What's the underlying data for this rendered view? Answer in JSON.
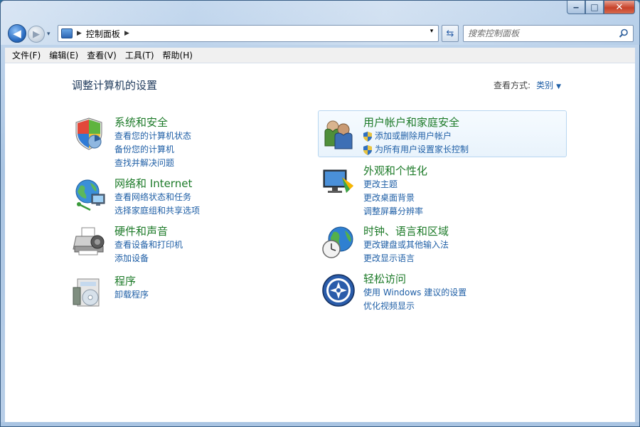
{
  "window": {
    "caption": {
      "minimize": "‒",
      "maximize": "□",
      "close": "✕"
    }
  },
  "navigation": {
    "back_glyph": "◀",
    "forward_glyph": "▶",
    "history_glyph": "▾",
    "address": {
      "separator": "▶",
      "path": "控制面板",
      "dropdown": "▾"
    },
    "refresh_glyph": "⇆",
    "search": {
      "placeholder": "搜索控制面板"
    }
  },
  "menu": {
    "items": [
      "文件(F)",
      "编辑(E)",
      "查看(V)",
      "工具(T)",
      "帮助(H)"
    ]
  },
  "content": {
    "title": "调整计算机的设置",
    "view_by": {
      "label": "查看方式:",
      "value": "类别",
      "arrow": "▼"
    },
    "categories": [
      {
        "title": "系统和安全",
        "icon": "shield-icon",
        "links": [
          "查看您的计算机状态",
          "备份您的计算机",
          "查找并解决问题"
        ]
      },
      {
        "title": "网络和 Internet",
        "icon": "network-icon",
        "links": [
          "查看网络状态和任务",
          "选择家庭组和共享选项"
        ]
      },
      {
        "title": "硬件和声音",
        "icon": "printer-icon",
        "links": [
          "查看设备和打印机",
          "添加设备"
        ]
      },
      {
        "title": "程序",
        "icon": "programs-icon",
        "links": [
          "卸载程序"
        ]
      },
      {
        "title": "用户帐户和家庭安全",
        "icon": "users-icon",
        "links": [
          "添加或删除用户帐户",
          "为所有用户设置家长控制"
        ]
      },
      {
        "title": "外观和个性化",
        "icon": "monitor-icon",
        "links": [
          "更改主题",
          "更改桌面背景",
          "调整屏幕分辨率"
        ]
      },
      {
        "title": "时钟、语言和区域",
        "icon": "clock-globe-icon",
        "links": [
          "更改键盘或其他输入法",
          "更改显示语言"
        ]
      },
      {
        "title": "轻松访问",
        "icon": "ease-of-access-icon",
        "links": [
          "使用 Windows 建议的设置",
          "优化视频显示"
        ]
      }
    ]
  },
  "colors": {
    "category_title": "#1c7a28",
    "link": "#1f5fa6",
    "heading": "#1e395b"
  }
}
